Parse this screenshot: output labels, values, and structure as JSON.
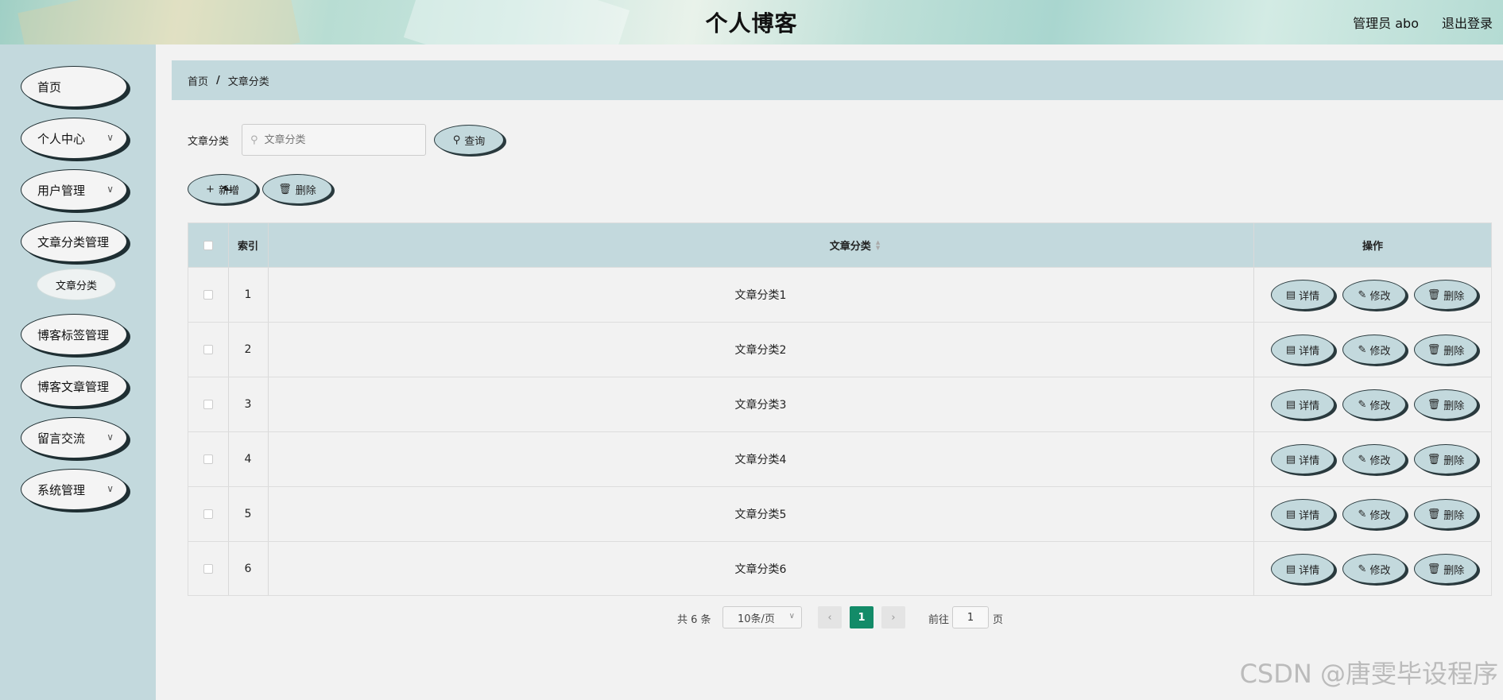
{
  "header": {
    "title": "个人博客",
    "admin": "管理员 abo",
    "logout": "退出登录"
  },
  "sidebar": {
    "items": [
      {
        "label": "首页"
      },
      {
        "label": "个人中心"
      },
      {
        "label": "用户管理"
      },
      {
        "label": "文章分类管理"
      },
      {
        "label": "文章分类"
      },
      {
        "label": "博客标签管理"
      },
      {
        "label": "博客文章管理"
      },
      {
        "label": "留言交流"
      },
      {
        "label": "系统管理"
      }
    ]
  },
  "breadcrumb": {
    "home": "首页",
    "sep": "/",
    "current": "文章分类"
  },
  "search": {
    "label": "文章分类",
    "placeholder": "文章分类",
    "button": "查询"
  },
  "toolbar": {
    "add": "新增",
    "delete": "删除"
  },
  "table": {
    "headers": {
      "index": "索引",
      "category": "文章分类",
      "actions": "操作"
    },
    "rows": [
      {
        "index": "1",
        "category": "文章分类1"
      },
      {
        "index": "2",
        "category": "文章分类2"
      },
      {
        "index": "3",
        "category": "文章分类3"
      },
      {
        "index": "4",
        "category": "文章分类4"
      },
      {
        "index": "5",
        "category": "文章分类5"
      },
      {
        "index": "6",
        "category": "文章分类6"
      }
    ],
    "actions": {
      "detail": "详情",
      "edit": "修改",
      "delete": "删除"
    }
  },
  "pagination": {
    "total": "共 6 条",
    "page_size": "10条/页",
    "current": "1",
    "goto_label": "前往",
    "goto_value": "1",
    "page_suffix": "页"
  },
  "watermark": "CSDN @唐雯毕设程序",
  "colors": {
    "accent": "#c3d9dd",
    "pager_active": "#138b68"
  }
}
